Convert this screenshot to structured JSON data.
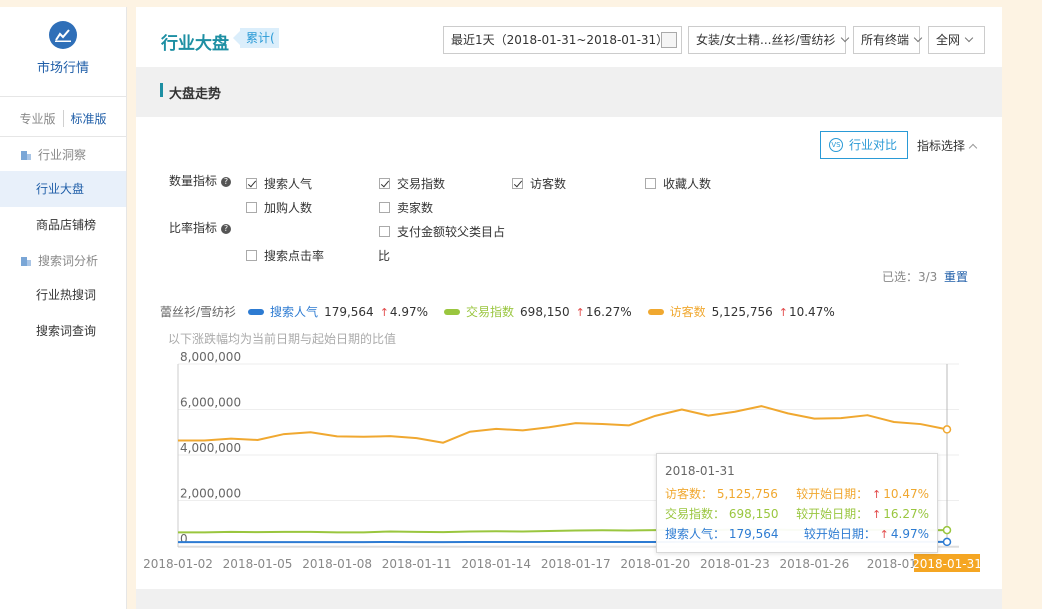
{
  "sidebar": {
    "brand": "市场行情",
    "versions": [
      "专业版",
      "标准版"
    ],
    "groups": [
      {
        "label": "行业洞察",
        "items": [
          "行业大盘",
          "商品店铺榜"
        ]
      },
      {
        "label": "搜索词分析",
        "items": [
          "行业热搜词",
          "搜索词查询"
        ]
      }
    ],
    "active_item": "行业大盘"
  },
  "header": {
    "title": "行业大盘",
    "tag": "累计(",
    "date_range": "最近1天（2018-01-31~2018-01-31）",
    "category": "女装/女士精...丝衫/雪纺衫",
    "terminal": "所有终端",
    "network": "全网"
  },
  "section": {
    "title": "大盘走势",
    "compare_button": "行业对比",
    "compare_badge": "VS",
    "indicator_select": "指标选择"
  },
  "indicators": {
    "quantity_label": "数量指标",
    "ratio_label": "比率指标",
    "help_glyph": "?",
    "quantity": [
      {
        "label": "搜索人气",
        "checked": true
      },
      {
        "label": "交易指数",
        "checked": true
      },
      {
        "label": "访客数",
        "checked": true
      },
      {
        "label": "收藏人数",
        "checked": false
      },
      {
        "label": "加购人数",
        "checked": false
      },
      {
        "label": "卖家数",
        "checked": false
      },
      {
        "label": "支付金额较父类目占",
        "checked": false
      }
    ],
    "ratio": [
      {
        "label": "搜索点击率",
        "checked": false
      }
    ],
    "ratio_suffix": "比",
    "selected": "已选：3/3",
    "reset": "重置"
  },
  "legend": {
    "category": "蕾丝衫/雪纺衫",
    "note": "以下涨跌幅均为当前日期与起始日期的比值",
    "items": [
      {
        "name": "搜索人气",
        "value": "179,564",
        "change": "4.97%",
        "color": "#2d7bd2"
      },
      {
        "name": "交易指数",
        "value": "698,150",
        "change": "16.27%",
        "color": "#9ac63f"
      },
      {
        "name": "访客数",
        "value": "5,125,756",
        "change": "10.47%",
        "color": "#f0a830"
      }
    ]
  },
  "tooltip": {
    "date": "2018-01-31",
    "rows": [
      {
        "name": "访客数：",
        "value": "5,125,756",
        "cmp": "较开始日期：",
        "change": "10.47%",
        "color": "#f0a830"
      },
      {
        "name": "交易指数：",
        "value": "698,150",
        "cmp": "较开始日期：",
        "change": "16.27%",
        "color": "#9ac63f"
      },
      {
        "name": "搜索人气：",
        "value": "179,564",
        "cmp": "较开始日期：",
        "change": "4.97%",
        "color": "#2d7bd2"
      }
    ]
  },
  "chart_data": {
    "type": "line",
    "x": [
      "2018-01-02",
      "2018-01-03",
      "2018-01-04",
      "2018-01-05",
      "2018-01-06",
      "2018-01-07",
      "2018-01-08",
      "2018-01-09",
      "2018-01-10",
      "2018-01-11",
      "2018-01-12",
      "2018-01-13",
      "2018-01-14",
      "2018-01-15",
      "2018-01-16",
      "2018-01-17",
      "2018-01-18",
      "2018-01-19",
      "2018-01-20",
      "2018-01-21",
      "2018-01-22",
      "2018-01-23",
      "2018-01-24",
      "2018-01-25",
      "2018-01-26",
      "2018-01-27",
      "2018-01-28",
      "2018-01-29",
      "2018-01-30",
      "2018-01-31"
    ],
    "xticks": [
      "2018-01-02",
      "2018-01-05",
      "2018-01-08",
      "2018-01-11",
      "2018-01-14",
      "2018-01-17",
      "2018-01-20",
      "2018-01-23",
      "2018-01-26",
      "2018-01-29",
      "2018-01-31"
    ],
    "xtick_labels": [
      "2018-01-02",
      "2018-01-05",
      "2018-01-08",
      "2018-01-11",
      "2018-01-14",
      "2018-01-17",
      "2018-01-20",
      "2018-01-23",
      "2018-01-26",
      "2018-01-",
      "2018-01-31"
    ],
    "highlight_x": "2018-01-31",
    "yticks": [
      "0",
      "2,000,000",
      "4,000,000",
      "6,000,000",
      "8,000,000"
    ],
    "ylim": [
      0,
      8000000
    ],
    "series": [
      {
        "name": "访客数",
        "color": "#f0a830",
        "values": [
          4640000,
          4640000,
          4720000,
          4660000,
          4920000,
          5000000,
          4820000,
          4800000,
          4830000,
          4740000,
          4540000,
          5020000,
          5150000,
          5080000,
          5220000,
          5400000,
          5360000,
          5300000,
          5720000,
          6000000,
          5730000,
          5900000,
          6150000,
          5830000,
          5600000,
          5620000,
          5750000,
          5450000,
          5360000,
          5125756
        ]
      },
      {
        "name": "交易指数",
        "color": "#9ac63f",
        "values": [
          600000,
          600000,
          620000,
          610000,
          620000,
          620000,
          600000,
          600000,
          640000,
          620000,
          610000,
          640000,
          650000,
          640000,
          660000,
          680000,
          690000,
          680000,
          700000,
          720000,
          700000,
          720000,
          730000,
          710000,
          690000,
          700000,
          710000,
          700000,
          690000,
          698150
        ]
      },
      {
        "name": "搜索人气",
        "color": "#2d7bd2",
        "values": [
          171000,
          171000,
          172000,
          171000,
          173000,
          173000,
          172000,
          172000,
          174000,
          173000,
          172000,
          175000,
          176000,
          175000,
          176000,
          177000,
          177000,
          177000,
          178000,
          179000,
          178000,
          179000,
          180000,
          179000,
          178000,
          178000,
          179000,
          179000,
          179000,
          179564
        ]
      }
    ]
  }
}
